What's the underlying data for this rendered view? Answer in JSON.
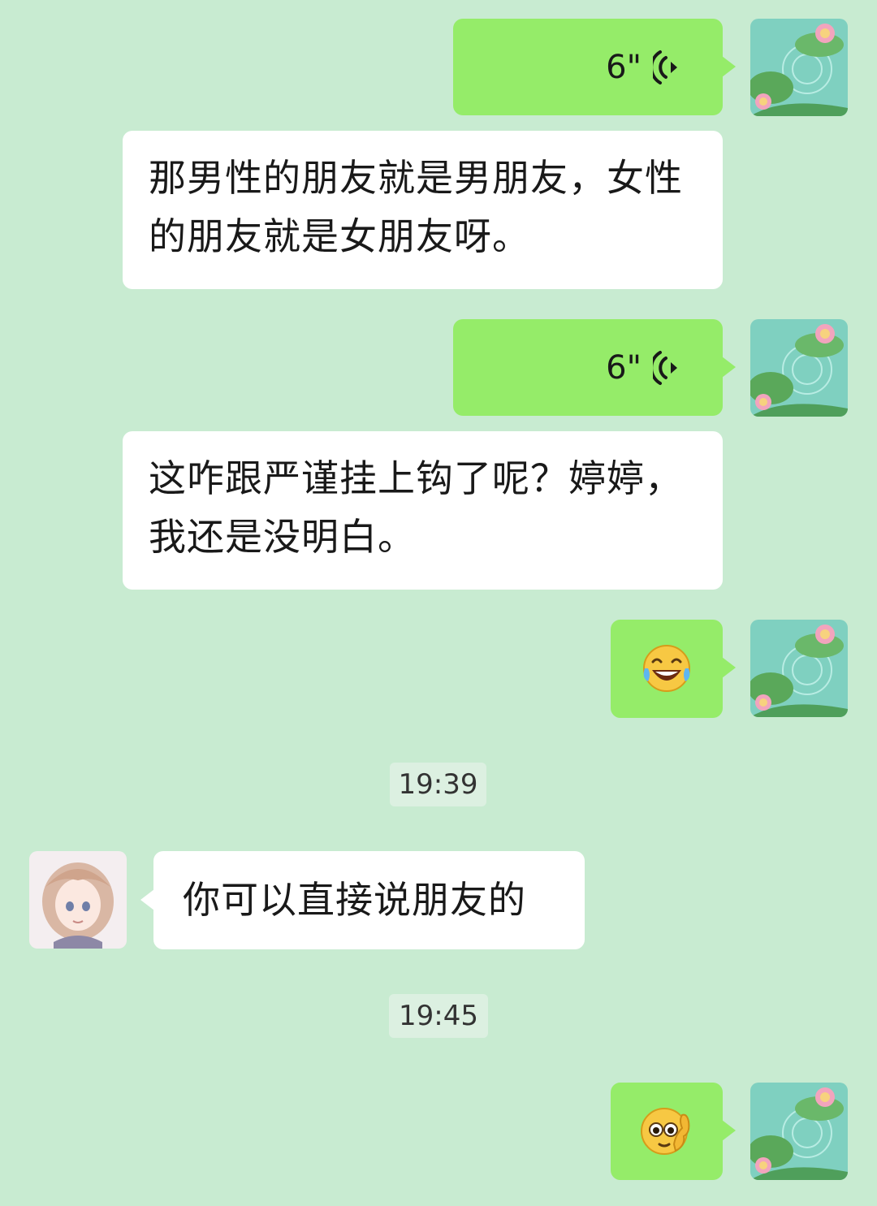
{
  "messages": [
    {
      "kind": "voice",
      "sender": "me",
      "duration": "6\""
    },
    {
      "kind": "text",
      "sender": "me",
      "text": "那男性的朋友就是男朋友，女性的朋友就是女朋友呀。"
    },
    {
      "kind": "voice",
      "sender": "me",
      "duration": "6\""
    },
    {
      "kind": "text",
      "sender": "me",
      "text": "这咋跟严谨挂上钩了呢？婷婷，我还是没明白。"
    },
    {
      "kind": "sticker",
      "sender": "me",
      "emoji": "laughing-with-tears-icon"
    },
    {
      "kind": "time",
      "text": "19:39"
    },
    {
      "kind": "text",
      "sender": "other",
      "text": "你可以直接说朋友的"
    },
    {
      "kind": "time",
      "text": "19:45"
    },
    {
      "kind": "sticker",
      "sender": "me",
      "emoji": "thinking-face-icon"
    }
  ],
  "colors": {
    "background": "#c8ebd1",
    "my_bubble": "#95ec69",
    "other_bubble": "#ffffff",
    "time_badge": "#dcf0e1"
  }
}
